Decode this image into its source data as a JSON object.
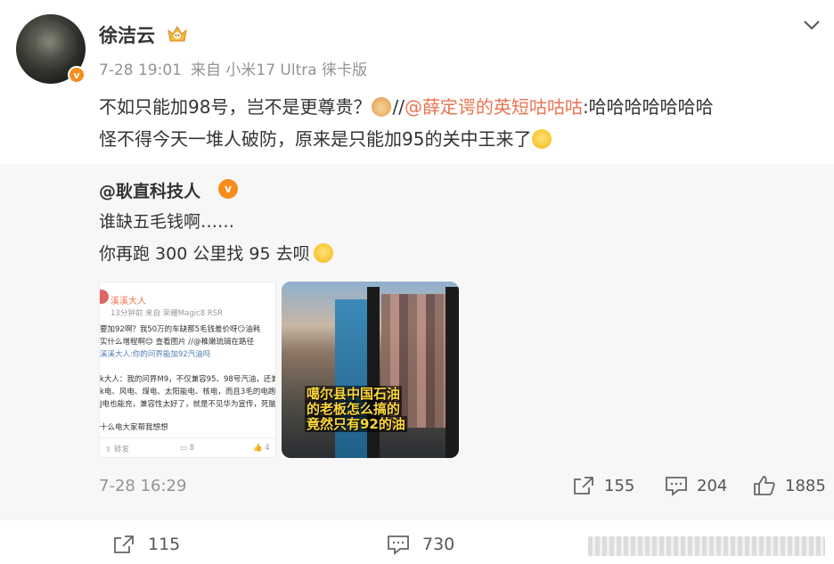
{
  "post": {
    "username": "徐洁云",
    "time": "7-28 19:01",
    "source": "来自 小米17 Ultra 徕卡版",
    "text_part1": "不如只能加98号，岂不是更尊贵？",
    "text_sep": "//",
    "mention": "@薛定谔的英短咕咕咕",
    "text_part2": ":哈哈哈哈哈哈哈",
    "text_line2": "怪不得今天一堆人破防，原来是只能加95的关中王来了",
    "verified_badge": "v"
  },
  "repost": {
    "username": "@耿直科技人",
    "verified_badge": "v",
    "line1": "谁缺五毛钱啊……",
    "line2": "你再跑 300 公里找 95 去呗",
    "time": "7-28 16:29",
    "shares": "155",
    "comments": "204",
    "likes": "1885",
    "image1": {
      "username": "溪溪大人",
      "meta": "13分钟前  来自 荣耀Magic8 RSR",
      "lines": [
        "要加92啊？我50万的车缺那5毛钱差价呀😏油耗",
        "实什么增程啊😊 查看图片  //@稚嫩琉璃在路径",
        "溪溪大人:你的问界能加92汽油吗",
        "",
        "k大人：我的问界M9，不仅兼容95、98号汽油，还兼",
        "k电、风电、煤电、太阳能电、核电，而且3毛的电跑",
        "J电也能充，兼容性太好了，就是不见华为宣传，死脑",
        "",
        "十么电大家帮我想想"
      ],
      "footer_share": "转发",
      "footer_comments": "8",
      "footer_likes": "4"
    },
    "image2": {
      "caption_line1": "噶尔县中国石油",
      "caption_line2": "的老板怎么搞的",
      "caption_line3": "竟然只有92的油"
    }
  },
  "actions": {
    "shares": "115",
    "comments": "730"
  },
  "colors": {
    "mention": "#eb7350",
    "verified": "#f78c1e",
    "muted": "#939393"
  }
}
